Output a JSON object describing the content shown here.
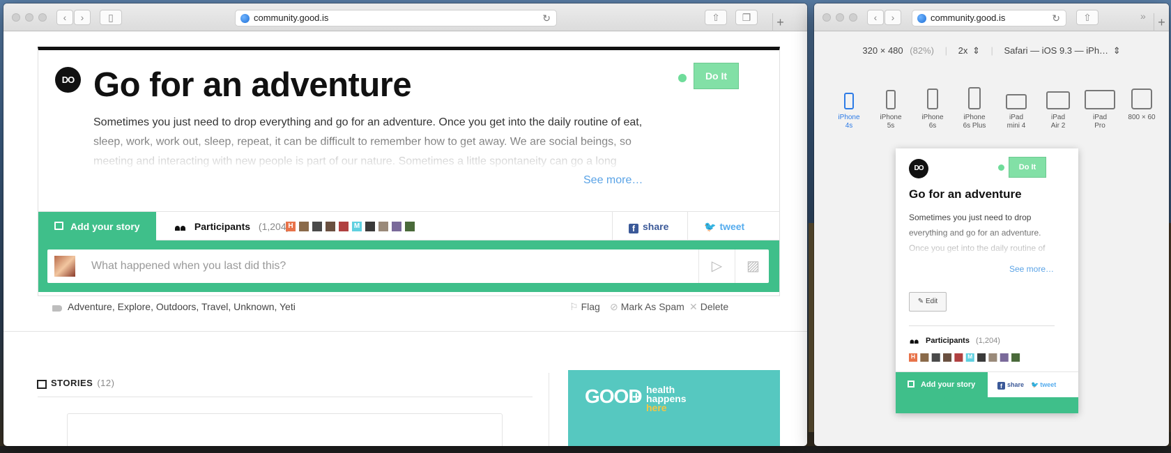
{
  "window_main": {
    "url": "community.good.is",
    "logo_text": "DO",
    "title": "Go for an adventure",
    "do_it_label": "Do It",
    "description": "Sometimes you just need to drop everything and go for an adventure. Once you get into the daily routine of eat, sleep, work, work out, sleep, repeat, it can be difficult to remember how to get away. We are social beings, so meeting and interacting with new people is part of our nature. Sometimes a little spontaneity can go a long",
    "see_more": "See more…",
    "add_story_label": "Add your story",
    "participants_label": "Participants",
    "participants_count": "(1,204)",
    "share_label": "share",
    "tweet_label": "tweet",
    "compose_placeholder": "What happened when you last did this?",
    "tags": "Adventure, Explore, Outdoors, Travel, Unknown, Yeti",
    "flag_label": "Flag",
    "spam_label": "Mark As Spam",
    "delete_label": "Delete",
    "stories_label": "STORIES",
    "stories_count": "(12)",
    "promo_good": "GOOD",
    "promo_plus": "+",
    "promo_health": "health",
    "promo_happens": "happens",
    "promo_here": "here"
  },
  "avatars": [
    {
      "letter": "H",
      "color": "#e8734a"
    },
    {
      "letter": "",
      "color": "#8a6a4a"
    },
    {
      "letter": "",
      "color": "#4a4a4a"
    },
    {
      "letter": "",
      "color": "#6a5040"
    },
    {
      "letter": "",
      "color": "#b04040"
    },
    {
      "letter": "M",
      "color": "#5fd0e0"
    },
    {
      "letter": "",
      "color": "#3a3a3a"
    },
    {
      "letter": "",
      "color": "#9a8a7a"
    },
    {
      "letter": "",
      "color": "#7a6a9a"
    },
    {
      "letter": "",
      "color": "#4a6a3a"
    }
  ],
  "window_resp": {
    "url": "community.good.is",
    "width": "320",
    "times": "×",
    "height": "480",
    "zoom": "(82%)",
    "scale": "2x",
    "ua": "Safari — iOS 9.3 — iPh…",
    "edit_label": "Edit"
  },
  "devices": [
    {
      "line1": "iPhone",
      "line2": "4s"
    },
    {
      "line1": "iPhone",
      "line2": "5s"
    },
    {
      "line1": "iPhone",
      "line2": "6s"
    },
    {
      "line1": "iPhone",
      "line2": "6s Plus"
    },
    {
      "line1": "iPad",
      "line2": "mini 4"
    },
    {
      "line1": "iPad",
      "line2": "Air 2"
    },
    {
      "line1": "iPad",
      "line2": "Pro"
    },
    {
      "line1": "800 × 60",
      "line2": ""
    }
  ],
  "colors": {
    "accent_green": "#3fbf8a",
    "doit_green": "#82e0a6",
    "link_blue": "#5aa3e6",
    "facebook": "#3b5998",
    "twitter": "#55acee"
  }
}
